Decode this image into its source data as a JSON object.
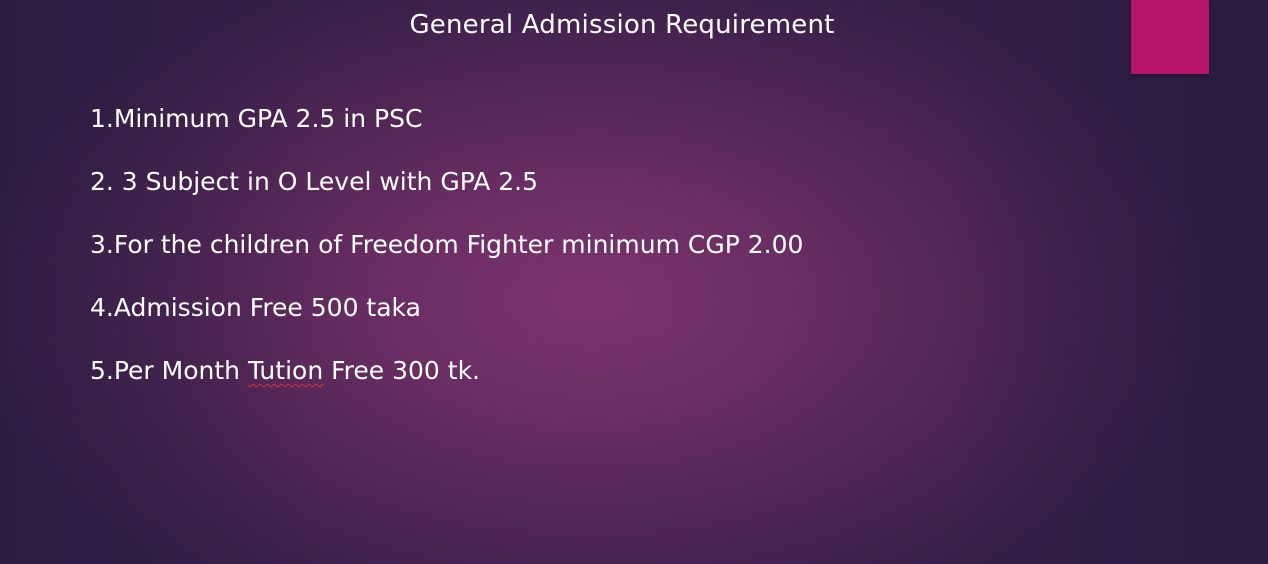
{
  "slide": {
    "title": "General Admission Requirement",
    "accent_color": "#b5156b",
    "items": [
      "1.Minimum GPA 2.5 in PSC",
      "2. 3 Subject in O Level with GPA 2.5",
      "3.For the children of Freedom Fighter minimum CGP 2.00",
      "4.Admission Free 500 taka"
    ],
    "item5": {
      "before": "5.Per Month ",
      "misspelled": "Tution",
      "after": " Free 300 tk."
    }
  }
}
